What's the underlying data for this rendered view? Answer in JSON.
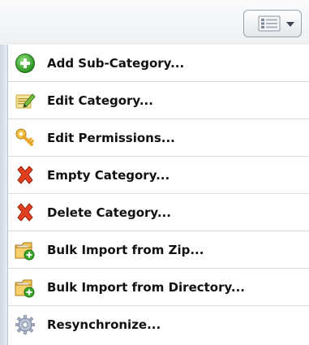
{
  "colors": {
    "add": "#2fa31f",
    "edit": "#e6c84a",
    "permissions": "#e8a62d",
    "danger": "#e03b1e",
    "folder": "#e8b64a",
    "sync": "#9aa7c0"
  },
  "toolbar": {
    "menu_button_icons": [
      "list-icon",
      "caret-down-icon"
    ]
  },
  "menu": {
    "items": [
      {
        "icon": "add-circle-icon",
        "label": "Add Sub-Category..."
      },
      {
        "icon": "edit-pencil-icon",
        "label": "Edit Category..."
      },
      {
        "icon": "key-icon",
        "label": "Edit Permissions..."
      },
      {
        "icon": "x-cross-icon",
        "label": "Empty Category..."
      },
      {
        "icon": "x-cross-icon",
        "label": "Delete Category..."
      },
      {
        "icon": "folder-import-icon",
        "label": "Bulk Import from Zip..."
      },
      {
        "icon": "folder-import-icon",
        "label": "Bulk Import from Directory..."
      },
      {
        "icon": "gear-sync-icon",
        "label": "Resynchronize..."
      }
    ]
  }
}
